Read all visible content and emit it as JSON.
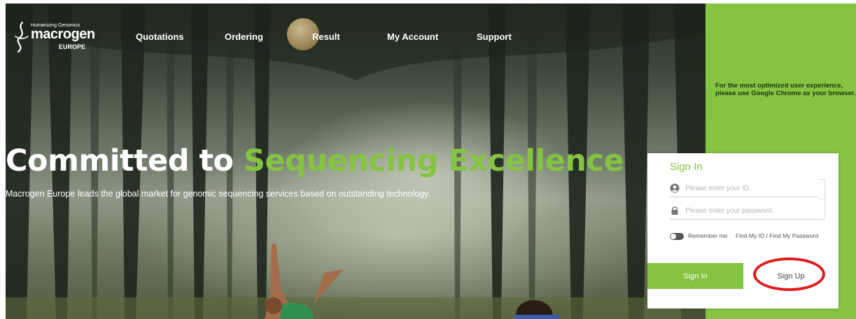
{
  "logo": {
    "tagline": "Humanizing Genomics",
    "brand": "macrogen",
    "region": "EUROPE"
  },
  "nav": {
    "items": [
      {
        "label": "Quotations"
      },
      {
        "label": "Ordering"
      },
      {
        "label": "Result"
      },
      {
        "label": "My Account"
      },
      {
        "label": "Support"
      }
    ]
  },
  "hero": {
    "title_start": "Committed to ",
    "title_accent": "Sequencing Excellence",
    "subtitle": "Macrogen Europe leads the global market for genomic sequencing services based on outstanding technology."
  },
  "browser_note": "For the most optimized user experience, please use Google Chrome as your browser.",
  "login": {
    "title": "Sign In",
    "id_placeholder": "Please enter your ID.",
    "password_placeholder": "Please enter your password.",
    "remember_label": "Remember me",
    "find_link": "Find My ID / Find My Password",
    "signin_label": "Sign In",
    "signup_label": "Sign Up"
  },
  "colors": {
    "brand_green": "#84c441",
    "highlight_red": "#e21b1b"
  },
  "icons": {
    "id_field": "user-icon",
    "password_field": "lock-icon"
  }
}
